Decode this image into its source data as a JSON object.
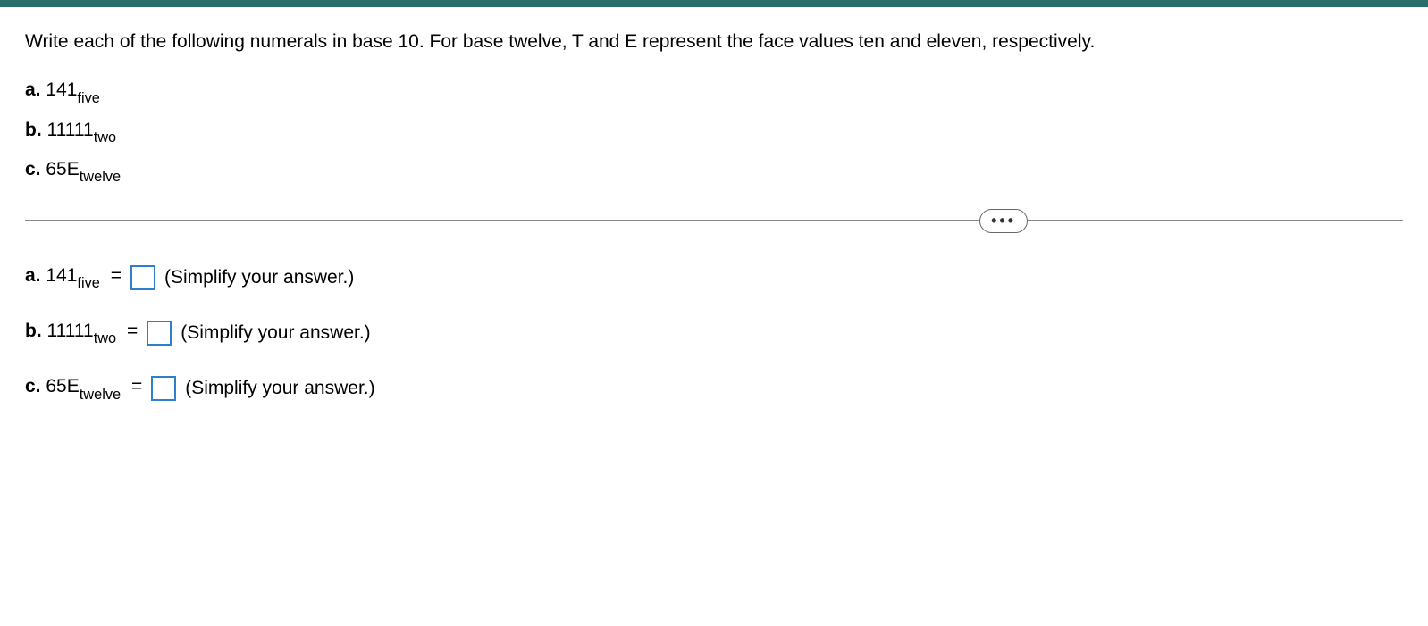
{
  "instruction": "Write each of the following numerals in base 10. For base twelve, T and E represent the face values ten and eleven, respectively.",
  "problems": {
    "a": {
      "label": "a.",
      "value": "141",
      "base": "five"
    },
    "b": {
      "label": "b.",
      "value": "11111",
      "base": "two"
    },
    "c": {
      "label": "c.",
      "value": "65E",
      "base": "twelve"
    }
  },
  "equals": "=",
  "hint": "(Simplify your answer.)",
  "more": "..."
}
